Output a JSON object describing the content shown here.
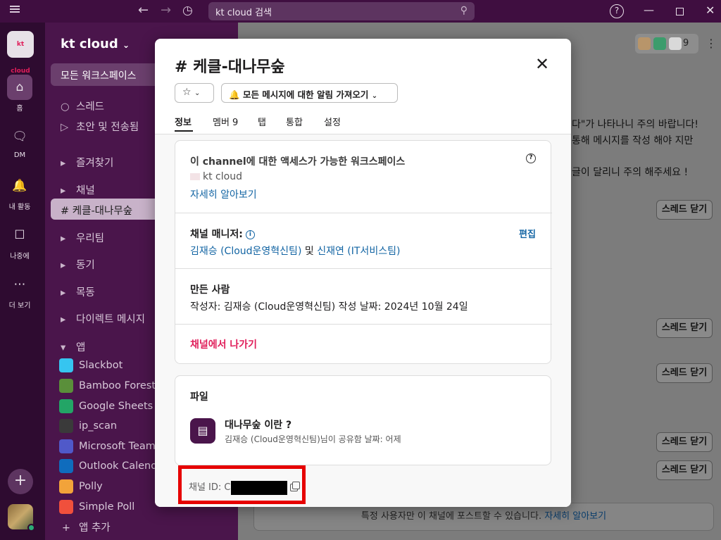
{
  "topbar": {
    "search_text": "kt cloud 검색"
  },
  "rail": {
    "workspace_logo": "kt cloud",
    "items": [
      {
        "label": "홈",
        "icon": "home-icon"
      },
      {
        "label": "DM",
        "icon": "dm-icon"
      },
      {
        "label": "내 활동",
        "icon": "bell-icon"
      },
      {
        "label": "나중에",
        "icon": "bookmark-icon"
      },
      {
        "label": "더 보기",
        "icon": "more-icon"
      }
    ]
  },
  "sidebar": {
    "workspace_name": "kt cloud",
    "all_workspaces": "모든 워크스페이스",
    "threads": "스레드",
    "drafts": "초안 및 전송됨",
    "favorites": "즐겨찾기",
    "channels": "채널",
    "selected_channel": "케클-대나무숲",
    "group_ours": "우리팀",
    "group_peers": "동기",
    "group_mokdong": "목동",
    "direct_messages": "다이렉트 메시지",
    "apps_header": "앱",
    "apps": [
      {
        "name": "Slackbot",
        "color": "#36c5f0"
      },
      {
        "name": "Bamboo Forest",
        "color": "#5a8f3a"
      },
      {
        "name": "Google Sheets V",
        "color": "#23a566"
      },
      {
        "name": "ip_scan",
        "color": "#3a3a3a"
      },
      {
        "name": "Microsoft Teams",
        "color": "#5059c9"
      },
      {
        "name": "Outlook Calend",
        "color": "#0f6cbd"
      },
      {
        "name": "Polly",
        "color": "#f2a33a"
      },
      {
        "name": "Simple Poll",
        "color": "#f0503c"
      }
    ],
    "add_app": "앱 추가"
  },
  "main": {
    "member_count": "9",
    "lines": [
      "다\"가 나타나니 주의 바랍니다!",
      "통해 메시지를 작성 해야 지만",
      "글이 달리니 주의 해주세요 !"
    ],
    "thread_close_label": "스레드 닫기",
    "bottom_notice": "특정 사용자만 이 채널에 포스트할 수 있습니다.",
    "bottom_link": "자세히 알아보기"
  },
  "modal": {
    "title": "# 케클-대나무숲",
    "notify_button": "모든 메시지에 대한 알림 가져오기",
    "tabs": [
      {
        "label": "정보",
        "active": true
      },
      {
        "label": "멤버 9",
        "active": false
      },
      {
        "label": "탭",
        "active": false
      },
      {
        "label": "통합",
        "active": false
      },
      {
        "label": "설정",
        "active": false
      }
    ],
    "access": {
      "heading": "이 channel에 대한 액세스가 가능한 워크스페이스",
      "workspace": "kt cloud",
      "learn_more": "자세히 알아보기"
    },
    "managers": {
      "heading": "채널 매니저:",
      "edit": "편집",
      "manager1": "김재승 (Cloud운영혁신팀)",
      "and": "및",
      "manager2": "신재연 (IT서비스팀)"
    },
    "creator": {
      "heading": "만든 사람",
      "detail": "작성자: 김재승 (Cloud운영혁신팀) 작성 날짜: 2024년 10월 24일"
    },
    "leave": "채널에서 나가기",
    "files": {
      "heading": "파일",
      "file_name": "대나무숲 이란 ?",
      "file_meta": "김재승 (Cloud운영혁신팀)님이 공유함 날짜: 어제"
    },
    "channel_id_label": "채널 ID: C"
  },
  "colors": {
    "sidebar": "#4a154b",
    "accent_link": "#1264a3",
    "danger": "#e01e5a",
    "highlight_box": "#e60000"
  }
}
